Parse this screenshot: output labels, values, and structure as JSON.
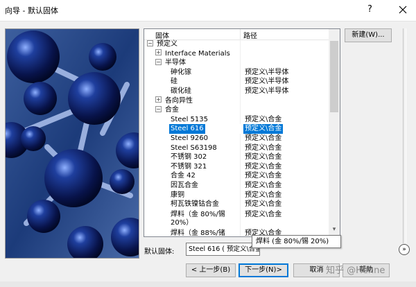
{
  "window": {
    "title": "向导 - 默认固体",
    "help_glyph": "?"
  },
  "tree": {
    "col_name": "固体",
    "col_path": "路径",
    "rows": [
      {
        "expander": "−",
        "name": "预定义",
        "path": "",
        "level": 0
      },
      {
        "expander": "+",
        "name": "Interface Materials",
        "path": "",
        "level": 1
      },
      {
        "expander": "−",
        "name": "半导体",
        "path": "",
        "level": 1
      },
      {
        "expander": "",
        "name": "砷化镓",
        "path": "预定义\\半导体",
        "level": 2
      },
      {
        "expander": "",
        "name": "硅",
        "path": "预定义\\半导体",
        "level": 2
      },
      {
        "expander": "",
        "name": "碳化硅",
        "path": "预定义\\半导体",
        "level": 2
      },
      {
        "expander": "+",
        "name": "各向异性",
        "path": "",
        "level": 1
      },
      {
        "expander": "−",
        "name": "合金",
        "path": "",
        "level": 1
      },
      {
        "expander": "",
        "name": "Steel 5135",
        "path": "预定义\\合金",
        "level": 2
      },
      {
        "expander": "",
        "name": "Steel 616",
        "path": "预定义\\合金",
        "level": 2,
        "selected": true
      },
      {
        "expander": "",
        "name": "Steel 9260",
        "path": "预定义\\合金",
        "level": 2
      },
      {
        "expander": "",
        "name": "Steel S63198",
        "path": "预定义\\合金",
        "level": 2
      },
      {
        "expander": "",
        "name": "不锈钢 302",
        "path": "预定义\\合金",
        "level": 2
      },
      {
        "expander": "",
        "name": "不锈钢 321",
        "path": "预定义\\合金",
        "level": 2
      },
      {
        "expander": "",
        "name": "合金 42",
        "path": "预定义\\合金",
        "level": 2
      },
      {
        "expander": "",
        "name": "因瓦合金",
        "path": "预定义\\合金",
        "level": 2
      },
      {
        "expander": "",
        "name": "康铜",
        "path": "预定义\\合金",
        "level": 2
      },
      {
        "expander": "",
        "name": "柯瓦铁镍钴合金",
        "path": "预定义\\合金",
        "level": 2
      },
      {
        "expander": "",
        "name": "焊料（金 80%/锡 20%）",
        "path": "预定义\\合金",
        "level": 2,
        "tall": true
      },
      {
        "expander": "",
        "name": "焊料（金 88%/锗 12%）",
        "path": "预定义\\合金",
        "level": 2,
        "tall": true
      }
    ]
  },
  "buttons": {
    "new": "新建(W)...",
    "prev": "< 上一步(B)",
    "next": "下一步(N)>",
    "cancel": "取消",
    "help": "帮助"
  },
  "default_solid": {
    "label": "默认固体:",
    "value": "Steel 616 ( 预定义\\合金 )"
  },
  "tooltip": "焊料 (金 80%/锡 20%)",
  "watermark": "知乎 @Henne",
  "colors": {
    "selection": "#0078d7",
    "image_dark": "#071a3e",
    "image_light": "#3a62a8"
  }
}
